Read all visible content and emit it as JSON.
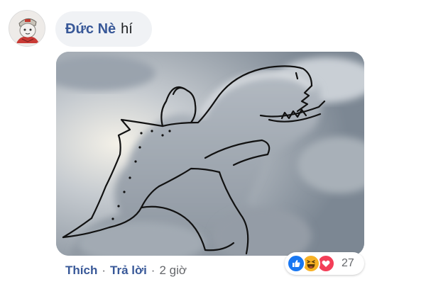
{
  "comment": {
    "author": "Đức Nè",
    "text": "hí"
  },
  "actions": {
    "like": "Thích",
    "separator": "·",
    "reply": "Trả lời",
    "time": "2 giờ"
  },
  "reactions": {
    "icons": [
      "like-icon",
      "haha-icon",
      "love-icon"
    ],
    "count": "27",
    "colors": {
      "like": "#1877f2",
      "haha": "#f7b125",
      "love": "#f33e58"
    }
  },
  "colors": {
    "author": "#385898",
    "bubble": "#f0f2f5",
    "meta": "#65676b"
  }
}
